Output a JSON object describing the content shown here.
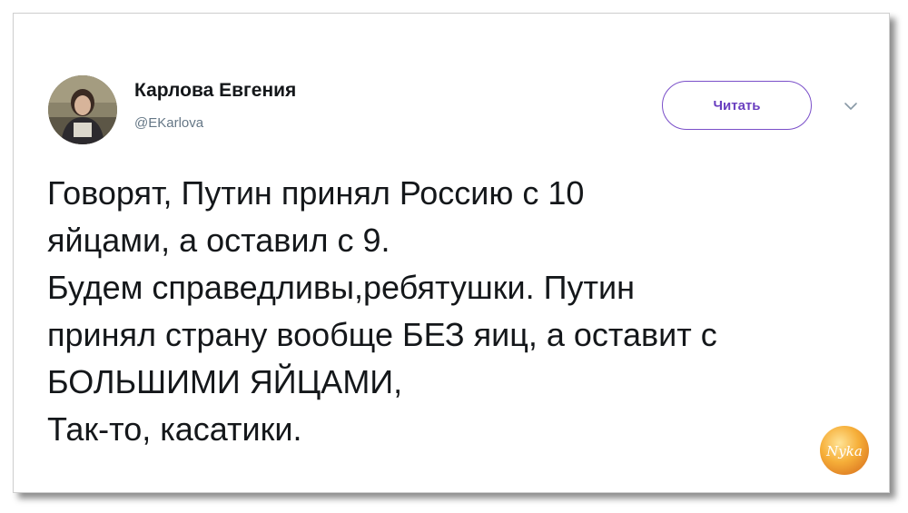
{
  "author": {
    "name": "Карлова Евгения",
    "handle": "@EKarlova"
  },
  "follow_button": {
    "label": "Читать"
  },
  "icons": {
    "chevron": "chevron-down-icon",
    "watermark": "logo-watermark"
  },
  "tweet": {
    "lines": [
      "Говорят, Путин принял Россию с 10",
      "яйцами, а оставил с 9.",
      "Будем справедливы,ребятушки. Путин",
      "принял страну вообще БЕЗ яиц, а оставит с",
      "БОЛЬШИМИ ЯЙЦАМИ,",
      "Так-то, касатики."
    ]
  },
  "watermark_text": "Nyka",
  "colors": {
    "accent": "#7a4fc9",
    "text": "#14171a",
    "muted": "#657786",
    "watermark": "#f5a623"
  }
}
